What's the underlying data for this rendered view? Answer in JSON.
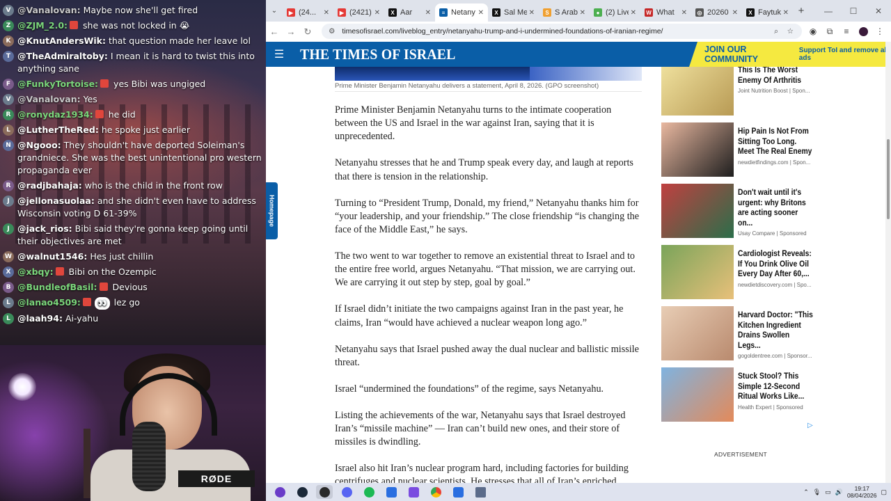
{
  "chat": [
    {
      "user": "@Vanalovan:",
      "text": "Maybe now she'll get fired",
      "color": "#c9c9c9",
      "avatar": "V",
      "badge": false
    },
    {
      "user": "@ZJM_2.0:",
      "text": "she was not locked in 😭",
      "color": "#7bd67b",
      "avatar": "Z",
      "badge": true
    },
    {
      "user": "@KnutAndersWik:",
      "text": "that question made her leave lol",
      "color": "#ffffff",
      "avatar": "K",
      "badge": false
    },
    {
      "user": "@TheAdmiraltoby:",
      "text": "I mean it is hard to twist this into anything sane",
      "color": "#ffffff",
      "avatar": "T",
      "badge": false
    },
    {
      "user": "@FunkyTortoise:",
      "text": "yes Bibi was ungiged",
      "color": "#7bd67b",
      "avatar": "F",
      "badge": true
    },
    {
      "user": "@Vanalovan:",
      "text": "Yes",
      "color": "#c9c9c9",
      "avatar": "V",
      "badge": false
    },
    {
      "user": "@ronydaz1934:",
      "text": "he did",
      "color": "#7bd67b",
      "avatar": "R",
      "badge": true
    },
    {
      "user": "@LutherTheRed:",
      "text": "he spoke just earlier",
      "color": "#ffffff",
      "avatar": "L",
      "badge": false
    },
    {
      "user": "@Ngooo:",
      "text": "They shouldn't have deported Soleiman's grandniece. She was the best unintentional pro western propaganda ever",
      "color": "#ffffff",
      "avatar": "N",
      "badge": false
    },
    {
      "user": "@radjbahaja:",
      "text": "who is the child in the front row",
      "color": "#ffffff",
      "avatar": "R",
      "badge": false
    },
    {
      "user": "@jellonasuolaa:",
      "text": "and she didn't even have to address Wisconsin voting D 61-39%",
      "color": "#ffffff",
      "avatar": "J",
      "badge": false
    },
    {
      "user": "@jack_rios:",
      "text": "Bibi said they're gonna keep going until their objectives are met",
      "color": "#ffffff",
      "avatar": "J",
      "badge": false
    },
    {
      "user": "@walnut1546:",
      "text": "Hes just chillin",
      "color": "#ffffff",
      "avatar": "W",
      "badge": false
    },
    {
      "user": "@xbqy:",
      "text": "Bibi on the Ozempic",
      "color": "#7bd67b",
      "avatar": "X",
      "badge": true
    },
    {
      "user": "@BundleofBasil:",
      "text": "Devious",
      "color": "#7bd67b",
      "avatar": "B",
      "badge": true
    },
    {
      "user": "@lanao4509:",
      "text": "lez go",
      "color": "#7bd67b",
      "avatar": "L",
      "badge": true,
      "emote": "👀"
    },
    {
      "user": "@laah94:",
      "text": "Ai-yahu",
      "color": "#ffffff",
      "avatar": "L",
      "badge": false
    }
  ],
  "homepage_tab": "Homepage",
  "tabs": [
    {
      "label": "(24...",
      "fav": "yt",
      "color": "#e53935"
    },
    {
      "label": "(2421)",
      "fav": "yt",
      "color": "#e53935"
    },
    {
      "label": "Aar",
      "fav": "x",
      "color": "#111111"
    },
    {
      "label": "Netany",
      "fav": "toi",
      "color": "#0a5ea7",
      "active": true
    },
    {
      "label": "Sal Me",
      "fav": "x",
      "color": "#111111"
    },
    {
      "label": "S Arab",
      "fav": "s",
      "color": "#f0a030"
    },
    {
      "label": "(2) Live",
      "fav": "g",
      "color": "#4caf50"
    },
    {
      "label": "What",
      "fav": "w",
      "color": "#c62828"
    },
    {
      "label": "20260",
      "fav": "c",
      "color": "#555555"
    },
    {
      "label": "Faytuk",
      "fav": "x",
      "color": "#111111"
    }
  ],
  "url": "timesofisrael.com/liveblog_entry/netanyahu-trump-and-i-undermined-foundations-of-iranian-regime/",
  "site": {
    "logo": "THE TIMES OF ISRAEL",
    "join": "JOIN OUR COMMUNITY",
    "support": "Support ToI and remove all ads"
  },
  "caption": "Prime Minister Benjamin Netanyahu delivers a statement, April 8, 2026. (GPO screenshot)",
  "paragraphs": [
    "Prime Minister Benjamin Netanyahu turns to the intimate cooperation between the US and Israel in the war against Iran, saying that it is unprecedented.",
    "Netanyahu stresses that he and Trump speak every day, and laugh at reports that there is tension in the relationship.",
    "Turning to “President Trump, Donald, my friend,” Netanyahu thanks him for “your leadership, and your friendship.” The close friendship “is changing the face of the Middle East,” he says.",
    "The two went to war together to remove an existential threat to Israel and to the entire free world, argues Netanyahu. “That mission, we are carrying out. We are carrying it out step by step, goal by goal.”",
    "If Israel didn’t initiate the two campaigns against Iran in the past year, he claims, Iran “would have achieved a nuclear weapon long ago.”",
    "Netanyahu says that Israel pushed away the dual nuclear and ballistic missile threat.",
    "Israel “undermined the foundations” of the regime, says Netanyahu.",
    "Listing the achievements of the war, Netanyahu says that Israel destroyed Iran’s “missile machine” — Iran can’t build new ones, and their store of missiles is dwindling.",
    "Israel also hit Iran’s nuclear program hard, including factories for building centrifuges and nuclear scientists. He stresses that all of Iran’s enriched"
  ],
  "ads": [
    {
      "title": "This Is The Worst Enemy Of Arthritis",
      "source": "Joint Nutrition Boost | Spon...",
      "c1": "#f1e3a0",
      "c2": "#b89a54"
    },
    {
      "title": "Hip Pain Is Not From Sitting Too Long. Meet The Real Enemy",
      "source": "newdietfindings.com | Spon...",
      "c1": "#e9b8a0",
      "c2": "#1e1e1e"
    },
    {
      "title": "Don't wait until it's urgent: why Britons are acting sooner on...",
      "source": "Usay Compare | Sponsored",
      "c1": "#c04040",
      "c2": "#2b6e4a"
    },
    {
      "title": "Cardiologist Reveals: If You Drink Olive Oil Every Day After 60,...",
      "source": "newdietdiscovery.com | Spo...",
      "c1": "#7aa45a",
      "c2": "#e8c07a"
    },
    {
      "title": "Harvard Doctor: \"This Kitchen Ingredient Drains Swollen Legs...",
      "source": "gogoldentree.com | Sponsor...",
      "c1": "#e8cdb5",
      "c2": "#b98a6e"
    },
    {
      "title": "Stuck Stool? This Simple 12-Second Ritual Works Like...",
      "source": "Health Expert | Sponsored",
      "c1": "#7fb3e0",
      "c2": "#e38a5a"
    }
  ],
  "advertisement": "ADVERTISEMENT",
  "clock": {
    "time": "19:17",
    "date": "08/04/2026"
  },
  "cam": {
    "brand": "RØDE"
  }
}
